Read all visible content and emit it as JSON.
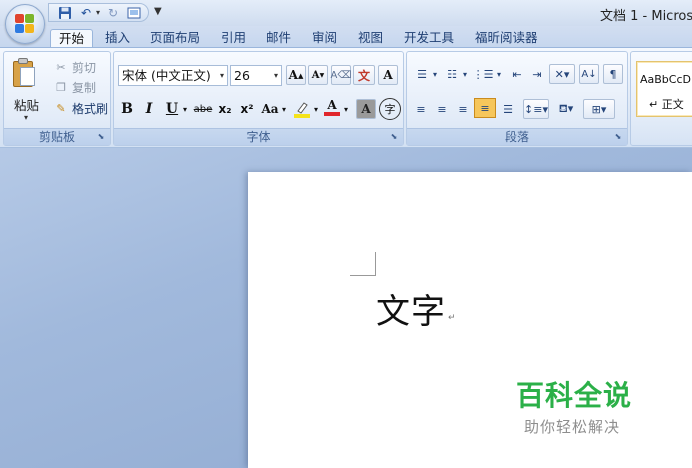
{
  "window": {
    "title": "文档 1 - Micros"
  },
  "quick_access": {
    "customize_glyph": "▼"
  },
  "tabs": [
    {
      "label": "开始",
      "active": true
    },
    {
      "label": "插入"
    },
    {
      "label": "页面布局"
    },
    {
      "label": "引用"
    },
    {
      "label": "邮件"
    },
    {
      "label": "审阅"
    },
    {
      "label": "视图"
    },
    {
      "label": "开发工具"
    },
    {
      "label": "福昕阅读器"
    }
  ],
  "clipboard": {
    "group_label": "剪贴板",
    "paste_label": "粘贴",
    "cut_label": "剪切",
    "copy_label": "复制",
    "format_painter_label": "格式刷"
  },
  "font": {
    "group_label": "字体",
    "font_name": "宋体 (中文正文)",
    "font_size": "26",
    "bold": "B",
    "italic": "I",
    "underline": "U",
    "strikethrough": "abe",
    "subscript": "x₂",
    "superscript": "x²",
    "change_case": "Aa",
    "grow": "A",
    "shrink": "A",
    "phonetic": "文",
    "border": "A",
    "shading": "A",
    "enclose": "字",
    "font_color": "A",
    "highlight_color": "#f5e31a",
    "font_color_value": "#e0262c"
  },
  "paragraph": {
    "group_label": "段落"
  },
  "styles": {
    "sample_text": "AaBbCcD",
    "style_name": "正文"
  },
  "document": {
    "body_text": "文字",
    "paragraph_mark": "↵"
  },
  "watermark": {
    "title": "百科全说",
    "subtitle": "助你轻松解决"
  }
}
